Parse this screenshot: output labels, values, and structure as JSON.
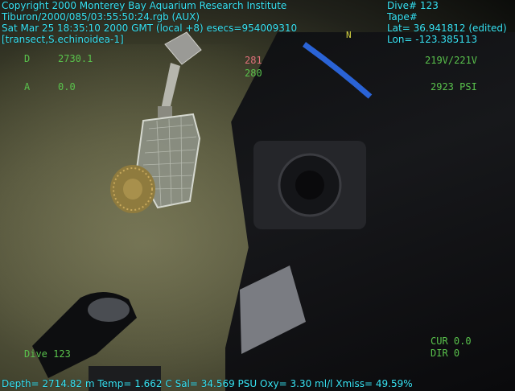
{
  "overlay_top": {
    "copyright": "Copyright 2000 Monterey Bay Aquarium Research Institute",
    "file": "Tiburon/2000/085/03:55:50:24.rgb (AUX)",
    "datetime": "Sat Mar 25 18:35:10 2000 GMT (local +8)  esecs=954009310",
    "tag": "[transect,S.echinoidea-1]",
    "dive": "Dive# 123",
    "tape": "Tape#",
    "lat": "Lat= 36.941812 (edited)",
    "lon": "Lon= -123.385113"
  },
  "overlay_hud": {
    "d_label": "D",
    "d_value": "2730.1",
    "a_label": "A",
    "a_value": "0.0",
    "red_top": "281",
    "red_bottom": "280",
    "voltage": "219V/221V",
    "pressure": "2923 PSI",
    "cur": "CUR 0.0",
    "dir": "DIR 0",
    "dive_small": "Dive 123",
    "compass_n": "N"
  },
  "overlay_bottom": {
    "telemetry": "Depth= 2714.82 m  Temp= 1.662 C  Sal= 34.569 PSU  Oxy= 3.30 ml/l  Xmiss= 49.59%"
  },
  "colors": {
    "hud_cyan": "#39e5f2",
    "hud_green": "#59c24c",
    "hud_red": "#e0707a"
  }
}
